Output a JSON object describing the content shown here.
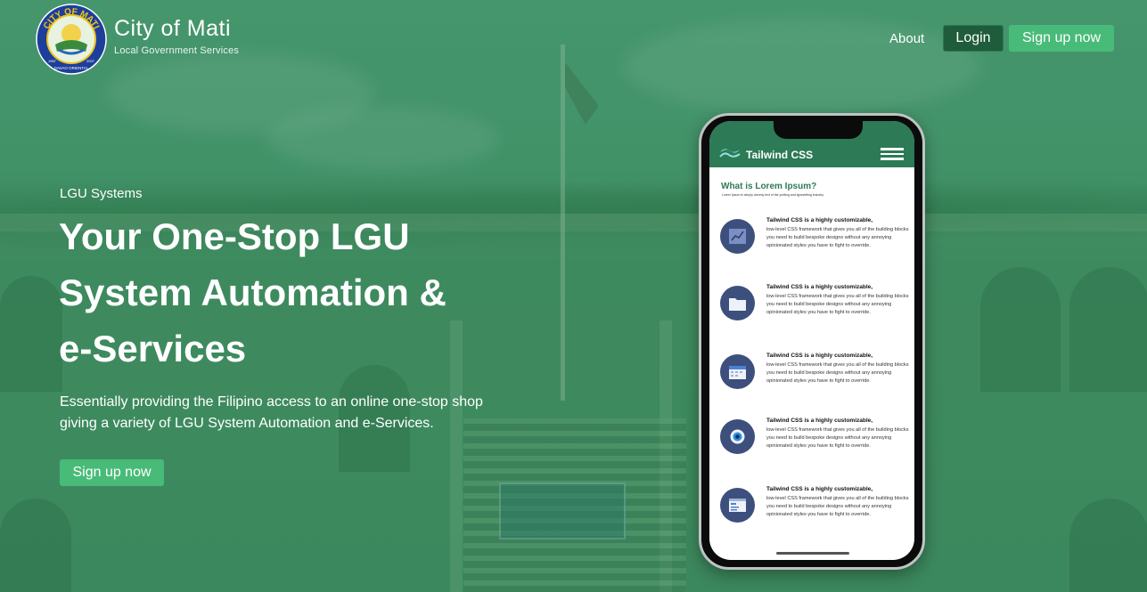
{
  "brand": {
    "title": "City of Mati",
    "subtitle": "Local Government Services",
    "logo_text_top": "CITY OF MATI",
    "logo_text_bottom": "DAVAO ORIENTAL",
    "logo_year_left": "1967",
    "logo_year_right": "2007"
  },
  "nav": {
    "about": "About",
    "login": "Login",
    "signup": "Sign up now"
  },
  "hero": {
    "eyebrow": "LGU Systems",
    "title_line1": "Your One-Stop LGU",
    "title_line2": "System Automation &",
    "title_line3": "e-Services",
    "description": "Essentially providing the Filipino access to an online one-stop shop giving a variety of LGU System Automation and e-Services.",
    "cta": "Sign up now"
  },
  "phone": {
    "app_title": "Tailwind CSS",
    "heading": "What is Lorem Ipsum?",
    "subheading": "Lorem Ipsum is simply dummy text of the printing and typesetting industry.",
    "features": [
      {
        "icon": "chart-icon",
        "title": "Tailwind CSS is a highly customizable,",
        "text": "low-level CSS framework that gives you all of the building blocks you need to build bespoke designs without any annoying opinionated styles you have to fight to override."
      },
      {
        "icon": "folder-icon",
        "title": "Tailwind CSS is a highly customizable,",
        "text": "low-level CSS framework that gives you all of the building blocks you need to build bespoke designs without any annoying opinionated styles you have to fight to override."
      },
      {
        "icon": "calendar-icon",
        "title": "Tailwind CSS is a highly customizable,",
        "text": "low-level CSS framework that gives you all of the building blocks you need to build bespoke designs without any annoying opinionated styles you have to fight to override."
      },
      {
        "icon": "camera-icon",
        "title": "Tailwind CSS is a highly customizable,",
        "text": "low-level CSS framework that gives you all of the building blocks you need to build bespoke designs without any annoying opinionated styles you have to fight to override."
      },
      {
        "icon": "browser-icon",
        "title": "Tailwind CSS is a highly customizable,",
        "text": "low-level CSS framework that gives you all of the building blocks you need to build bespoke designs without any annoying opinionated styles you have to fight to override."
      }
    ]
  },
  "colors": {
    "accent": "#48bb78",
    "login_bg": "#1e5c3b",
    "overlay": "#2e8b57",
    "phone_header": "#2d7a56"
  }
}
